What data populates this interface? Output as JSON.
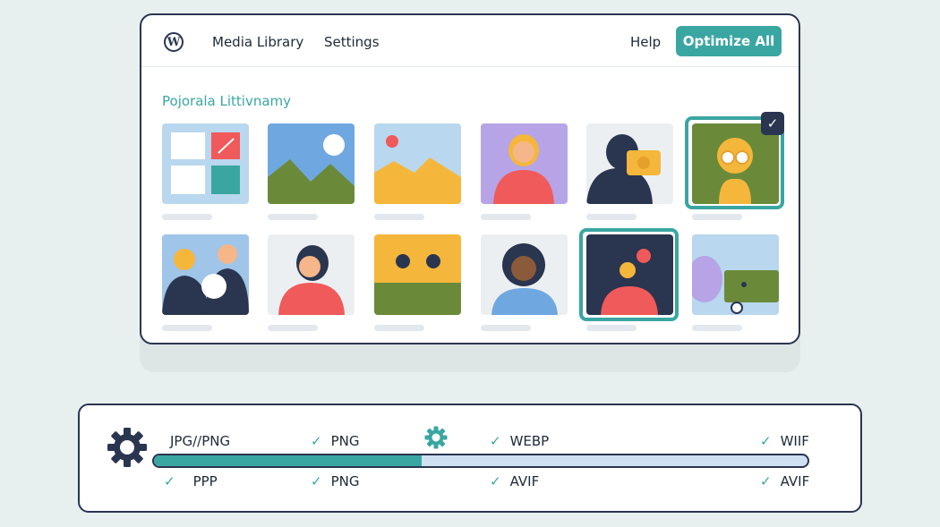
{
  "app": {
    "logo_letter": "W",
    "nav": {
      "media_library": "Media Library",
      "settings": "Settings",
      "help": "Help"
    },
    "optimize_button": "Optimize All"
  },
  "library": {
    "title": "Pojorala Littivnamy",
    "items": [
      {
        "name": "layout-grid",
        "selected": false
      },
      {
        "name": "landscape-sun",
        "selected": false
      },
      {
        "name": "mountains-warm",
        "selected": false
      },
      {
        "name": "portrait-woman-purple",
        "selected": false
      },
      {
        "name": "person-with-camera",
        "selected": false
      },
      {
        "name": "portrait-glasses",
        "selected": true
      },
      {
        "name": "two-people",
        "selected": false
      },
      {
        "name": "portrait-woman-red",
        "selected": false
      },
      {
        "name": "dots-landscape",
        "selected": false
      },
      {
        "name": "portrait-curly-hair",
        "selected": false
      },
      {
        "name": "dark-portrait",
        "selected": true
      },
      {
        "name": "video-clip",
        "selected": false
      }
    ],
    "check_glyph": "✓"
  },
  "conversion": {
    "progress": 0.41,
    "check_glyph": "✓",
    "top_formats": [
      "JPG//PNG",
      "PNG",
      "WEBP",
      "WIIF"
    ],
    "bottom_formats": [
      "PPP",
      "PNG",
      "AVIF",
      "AVIF"
    ],
    "colors": {
      "accent": "#3aa6a2",
      "track": "#cfe0f3",
      "dark": "#2a3550"
    }
  }
}
